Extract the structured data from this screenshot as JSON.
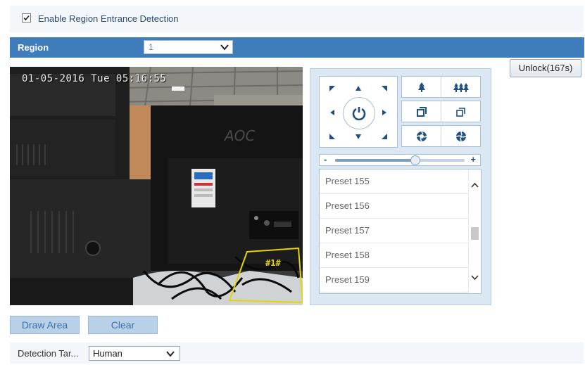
{
  "enable": {
    "label": "Enable Region Entrance Detection",
    "checked": true
  },
  "region": {
    "label": "Region",
    "selected": "1"
  },
  "unlock_label": "Unlock(167s)",
  "video": {
    "osd_time": "01-05-2016 Tue 05:16:55",
    "region_tag": "#1#",
    "monitor_brand": "AOC"
  },
  "ptz": {
    "pad_icons": [
      "arrow-up-left-icon",
      "arrow-up-icon",
      "arrow-up-right-icon",
      "arrow-left-icon",
      "auto-rotate-icon",
      "arrow-right-icon",
      "arrow-down-left-icon",
      "arrow-down-icon",
      "arrow-down-right-icon"
    ],
    "ctrl_icons": [
      "zoom-in-icon",
      "zoom-out-icon",
      "focus-near-icon",
      "focus-far-icon",
      "iris-open-icon",
      "iris-close-icon"
    ],
    "speed": 0.62,
    "speed_minus": "-",
    "speed_plus": "+",
    "presets": [
      "Preset 155",
      "Preset 156",
      "Preset 157",
      "Preset 158",
      "Preset 159"
    ]
  },
  "buttons": {
    "draw_area": "Draw Area",
    "clear": "Clear"
  },
  "detection": {
    "label": "Detection Tar...",
    "selected": "Human"
  },
  "colors": {
    "accent": "#3f7cba",
    "button_bg": "#b9d1e8",
    "panel_bg": "#dbe8f4",
    "detection_box": "#e6d400"
  }
}
